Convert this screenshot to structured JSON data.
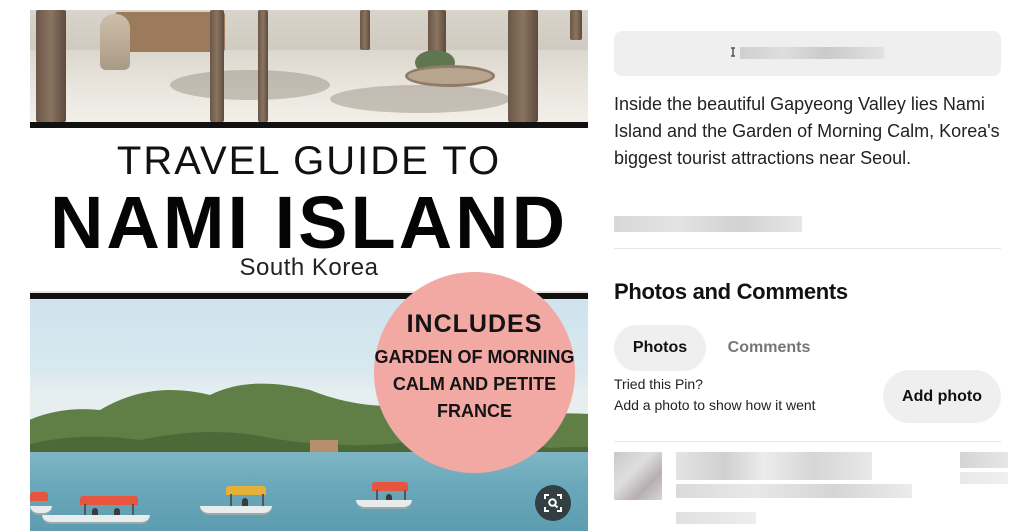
{
  "pin_image": {
    "title_line1": "TRAVEL GUIDE TO",
    "title_line2": "NAMI ISLAND",
    "title_line3": "South Korea",
    "badge_line1": "INCLUDES",
    "badge_line2": "GARDEN OF MORNING CALM AND PETITE FRANCE",
    "badge_color": "#f2a8a3",
    "lens_icon": "visual-search-icon"
  },
  "details": {
    "link_icon": "link-icon",
    "description": "Inside the beautiful Gapyeong Valley lies Nami Island and the Garden of Morning Calm, Korea's biggest tourist attractions near Seoul."
  },
  "photos_comments": {
    "heading": "Photos and Comments",
    "tabs": [
      {
        "label": "Photos",
        "selected": true
      },
      {
        "label": "Comments",
        "selected": false
      }
    ],
    "tried_prompt": "Tried this Pin?",
    "tried_hint": "Add a photo to show how it went",
    "add_photo_label": "Add photo"
  },
  "colors": {
    "button_bg": "#efefef",
    "inactive_tab_text": "#767676"
  }
}
